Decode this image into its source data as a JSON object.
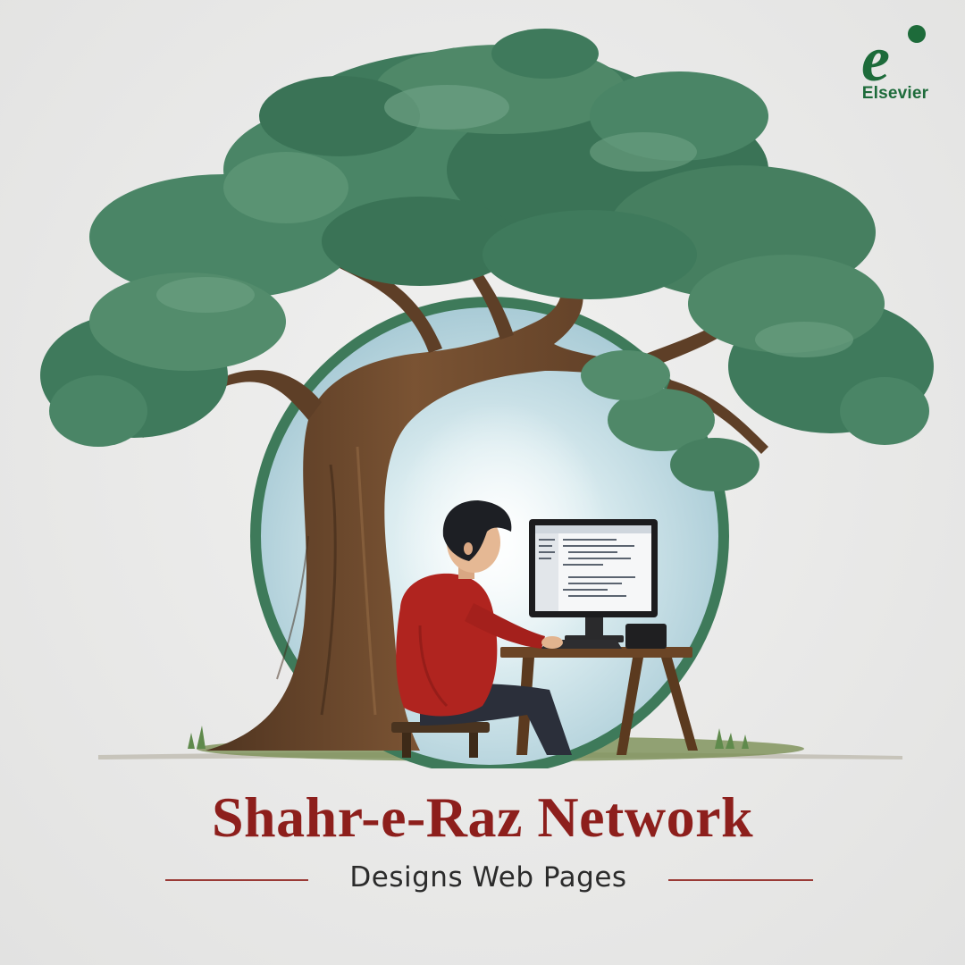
{
  "brand": {
    "logo_text": "Elsevier",
    "logo_letter": "e"
  },
  "headline": {
    "title": "Shahr-e-Raz Network",
    "subtitle": "Designs Web Pages"
  },
  "colors": {
    "title_red": "#8d1f1c",
    "foliage_green": "#3f7a5c",
    "ring_green": "#3e7a5a",
    "sky_blue": "#cfe4ea",
    "shirt_red": "#b0241f",
    "trunk_brown": "#6e4a2c",
    "logo_green": "#1d6b3a"
  },
  "icons": [
    "elsevier-logo-icon",
    "tree-illustration",
    "monitor-icon"
  ]
}
